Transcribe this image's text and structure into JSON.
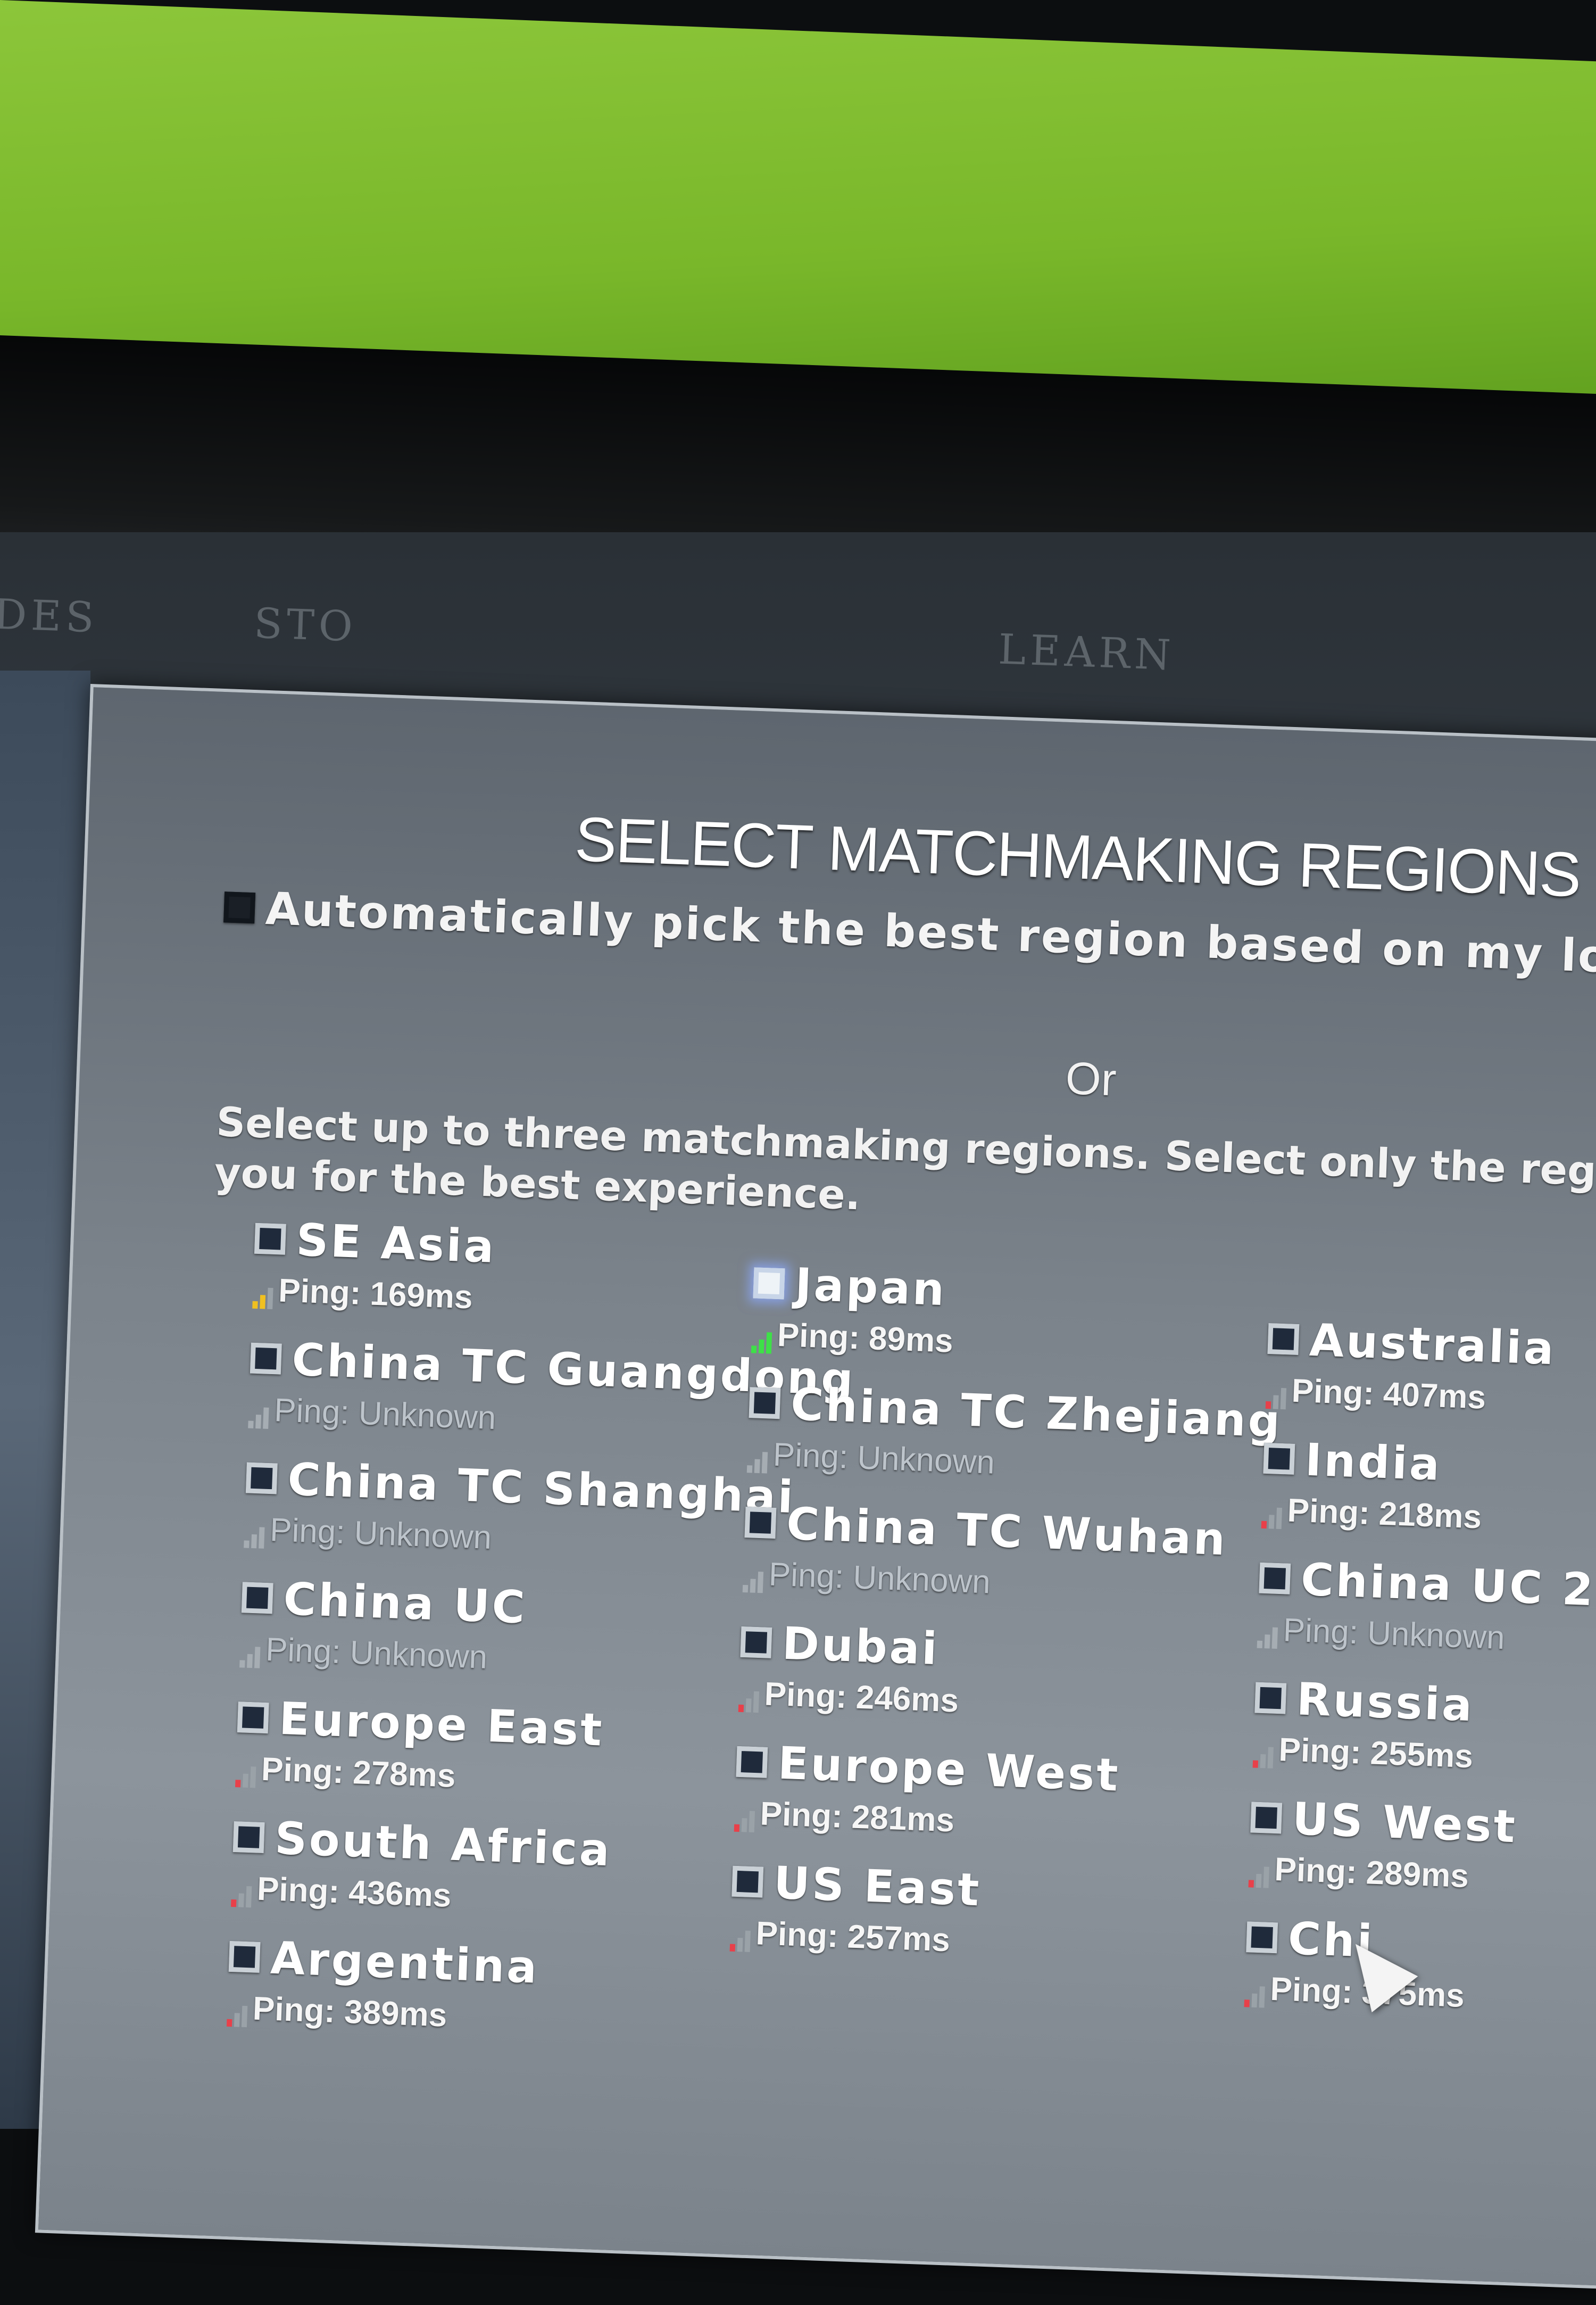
{
  "topnav": {
    "items": [
      "DES",
      "STO",
      "LEARN"
    ]
  },
  "dialog": {
    "title": "SELECT MATCHMAKING REGIONS",
    "auto_pick_label": "Automatically pick the best region based on my loc",
    "or_label": "Or",
    "instructions_line1": "Select up to three matchmaking regions. Select only the region",
    "instructions_line2": "you for the best experience."
  },
  "regions": {
    "col1": [
      {
        "name": "SE Asia",
        "ping": "Ping: 169ms",
        "level": "mid",
        "checked": false
      },
      {
        "name": "China TC Guangdong",
        "ping": "Ping: Unknown",
        "level": "none",
        "checked": false
      },
      {
        "name": "China TC Shanghai",
        "ping": "Ping: Unknown",
        "level": "none",
        "checked": false
      },
      {
        "name": "China UC",
        "ping": "Ping: Unknown",
        "level": "none",
        "checked": false
      },
      {
        "name": "Europe East",
        "ping": "Ping: 278ms",
        "level": "bad",
        "checked": false
      },
      {
        "name": "South Africa",
        "ping": "Ping: 436ms",
        "level": "bad",
        "checked": false
      },
      {
        "name": "Argentina",
        "ping": "Ping: 389ms",
        "level": "bad",
        "checked": false
      }
    ],
    "col2": [
      {
        "name": "Japan",
        "ping": "Ping: 89ms",
        "level": "good",
        "checked": true
      },
      {
        "name": "China TC Zhejiang",
        "ping": "Ping: Unknown",
        "level": "none",
        "checked": false
      },
      {
        "name": "China TC Wuhan",
        "ping": "Ping: Unknown",
        "level": "none",
        "checked": false
      },
      {
        "name": "Dubai",
        "ping": "Ping: 246ms",
        "level": "bad",
        "checked": false
      },
      {
        "name": "Europe West",
        "ping": "Ping: 281ms",
        "level": "bad",
        "checked": false
      },
      {
        "name": "US East",
        "ping": "Ping: 257ms",
        "level": "bad",
        "checked": false
      }
    ],
    "col3": [
      {
        "name": "Australia",
        "ping": "Ping: 407ms",
        "level": "bad",
        "checked": false
      },
      {
        "name": "India",
        "ping": "Ping: 218ms",
        "level": "bad",
        "checked": false
      },
      {
        "name": "China UC 2",
        "ping": "Ping: Unknown",
        "level": "none",
        "checked": false
      },
      {
        "name": "Russia",
        "ping": "Ping: 255ms",
        "level": "bad",
        "checked": false
      },
      {
        "name": "US West",
        "ping": "Ping: 289ms",
        "level": "bad",
        "checked": false
      },
      {
        "name": "Chi",
        "ping": "Ping: 375ms",
        "level": "bad",
        "checked": false
      }
    ]
  },
  "colors": {
    "wall_green": "#7fbf2e",
    "ping_good": "#3ee048",
    "ping_mid": "#f0c020",
    "ping_bad": "#e8404a",
    "selected_glow": "#8caaff"
  },
  "icons": {
    "checkbox": "square-checkbox",
    "ping": "signal-bars-icon",
    "cursor": "mouse-pointer-icon"
  }
}
